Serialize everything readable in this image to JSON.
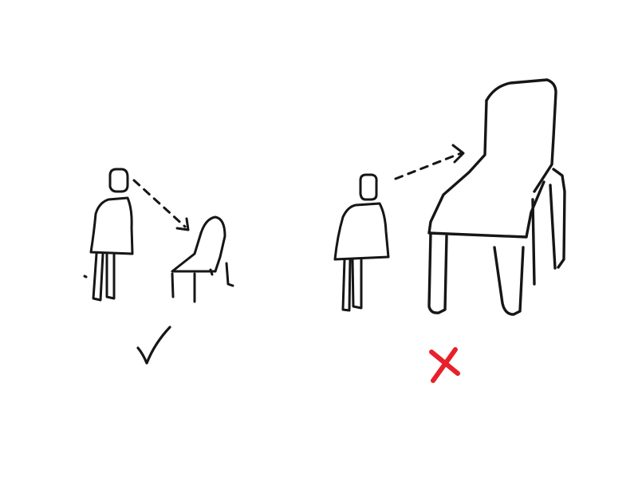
{
  "colors": {
    "background": "#ffffff",
    "ink": "#161616",
    "correct_mark": "#161616",
    "wrong_mark": "#e8202a"
  },
  "panels": [
    {
      "id": "left",
      "figures": [
        "person",
        "chair-small"
      ],
      "arrow": "dashed-arrow",
      "verdict_icon": "check-mark-icon",
      "verdict": "correct"
    },
    {
      "id": "right",
      "figures": [
        "person",
        "chair-oversized"
      ],
      "arrow": "dashed-arrow",
      "verdict_icon": "cross-mark-icon",
      "verdict": "wrong"
    }
  ]
}
